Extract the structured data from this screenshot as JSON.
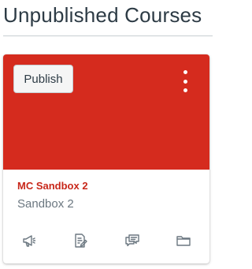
{
  "section": {
    "title": "Unpublished Courses"
  },
  "course": {
    "name": "MC Sandbox 2",
    "subtitle": "Sandbox 2",
    "publish_label": "Publish",
    "hero_color": "#d52b1e",
    "name_color": "#c8281b"
  },
  "actions": [
    {
      "icon": "announcements-icon"
    },
    {
      "icon": "assignments-icon"
    },
    {
      "icon": "discussions-icon"
    },
    {
      "icon": "files-icon"
    }
  ]
}
